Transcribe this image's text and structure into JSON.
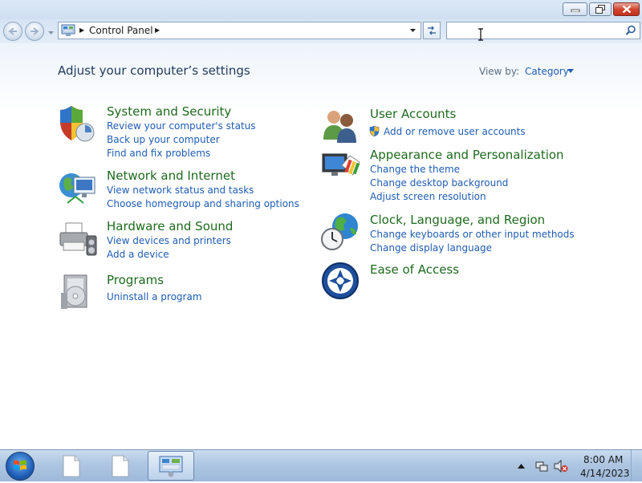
{
  "window": {
    "caption_buttons": {
      "minimize": "minimize-icon",
      "maximize": "restore-icon",
      "close": "close-icon"
    }
  },
  "navigation": {
    "back_icon": "back-arrow-icon",
    "forward_icon": "forward-arrow-icon",
    "breadcrumb": [
      "Control Panel"
    ],
    "search_placeholder": "",
    "search_icon": "magnifier-icon",
    "refresh_icon": "refresh-icon"
  },
  "main": {
    "heading": "Adjust your computer’s settings",
    "view_by_label": "View by:",
    "view_by_value": "Category"
  },
  "categories": [
    {
      "icon": "shield-icon",
      "title": "System and Security",
      "links": [
        "Review your computer's status",
        "Back up your computer",
        "Find and fix problems"
      ]
    },
    {
      "icon": "network-globe-icon",
      "title": "Network and Internet",
      "links": [
        "View network status and tasks",
        "Choose homegroup and sharing options"
      ]
    },
    {
      "icon": "printer-icon",
      "title": "Hardware and Sound",
      "links": [
        "View devices and printers",
        "Add a device"
      ]
    },
    {
      "icon": "programs-box-icon",
      "title": "Programs",
      "links": [
        "Uninstall a program"
      ]
    },
    {
      "icon": "users-icon",
      "title": "User Accounts",
      "links": [
        "Add or remove user accounts"
      ]
    },
    {
      "icon": "monitor-palette-icon",
      "title": "Appearance and Personalization",
      "links": [
        "Change the theme",
        "Change desktop background",
        "Adjust screen resolution"
      ]
    },
    {
      "icon": "globe-clock-icon",
      "title": "Clock, Language, and Region",
      "links": [
        "Change keyboards or other input methods",
        "Change display language"
      ]
    },
    {
      "icon": "ease-of-access-icon",
      "title": "Ease of Access",
      "links": []
    }
  ],
  "taskbar": {
    "start_icon": "windows-logo-icon",
    "items": [
      {
        "icon": "document-icon",
        "active": false
      },
      {
        "icon": "document-icon",
        "active": false
      },
      {
        "icon": "control-panel-icon",
        "active": true
      }
    ],
    "clock_time": "8:00 AM",
    "clock_date": "4/14/2023"
  },
  "colors": {
    "category_title": "#1d6a1d",
    "link": "#1e5cb3",
    "heading": "#1e395b"
  }
}
